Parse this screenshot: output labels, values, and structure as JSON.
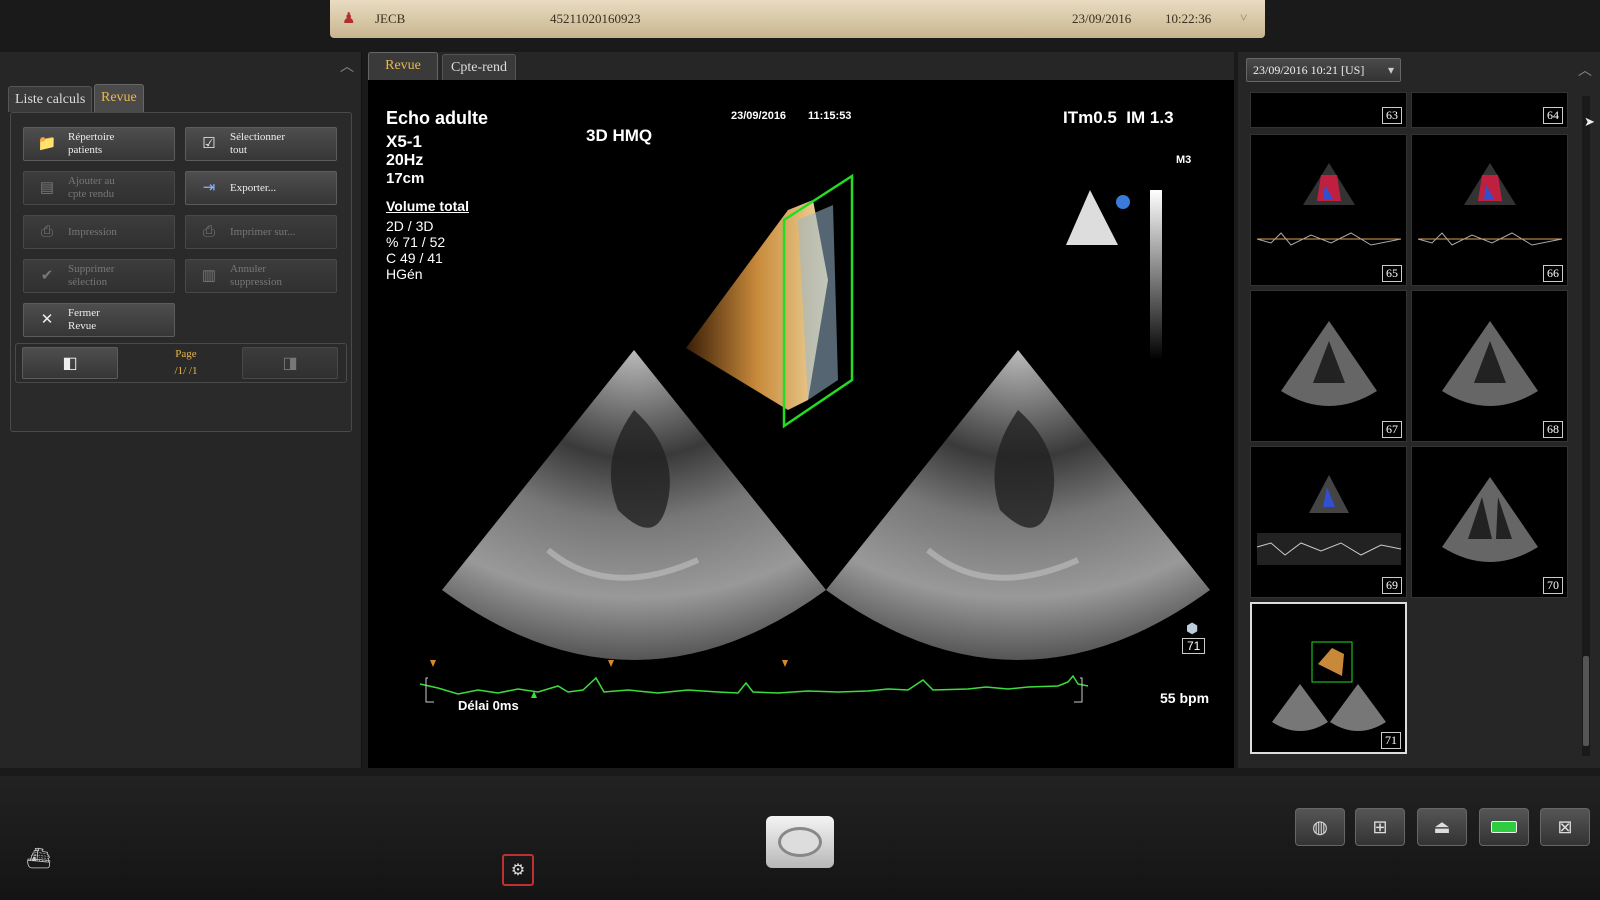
{
  "header": {
    "patient_name": "JECB",
    "patient_id": "45211020160923",
    "date": "23/09/2016",
    "time": "10:22:36"
  },
  "left_panel": {
    "tabs": [
      {
        "label": "Liste calculs",
        "active": false
      },
      {
        "label": "Revue",
        "active": true
      }
    ],
    "buttons": [
      {
        "label": "Répertoire\npatients",
        "enabled": true,
        "icon": "patient-folder-icon"
      },
      {
        "label": "Sélectionner\ntout",
        "enabled": true,
        "icon": "select-all-icon"
      },
      {
        "label": "Ajouter au\ncpte rendu",
        "enabled": false,
        "icon": "add-report-icon"
      },
      {
        "label": "Exporter...",
        "enabled": true,
        "icon": "export-icon"
      },
      {
        "label": "Impression",
        "enabled": false,
        "icon": "printer-icon"
      },
      {
        "label": "Imprimer sur...",
        "enabled": false,
        "icon": "print-to-icon"
      },
      {
        "label": "Supprimer\nsélection",
        "enabled": false,
        "icon": "delete-selection-icon"
      },
      {
        "label": "Annuler\nsuppression",
        "enabled": false,
        "icon": "undo-delete-icon"
      },
      {
        "label": "Fermer\nRevue",
        "enabled": true,
        "icon": "close-icon"
      }
    ],
    "page_label": "Page",
    "page_value": "/1/ /1"
  },
  "center": {
    "tabs": [
      {
        "label": "Revue",
        "active": true
      },
      {
        "label": "Cpte-rend",
        "active": false
      }
    ],
    "exam_type": "Echo adulte",
    "probe": "X5-1",
    "frequency": "20Hz",
    "depth": "17cm",
    "mode": "3D  HMQ",
    "image_date": "23/09/2016",
    "image_time": "11:15:53",
    "indices": "ITm0.5  IM 1.3",
    "map": "M3",
    "volume_title": "Volume total",
    "volume_values": "2D / 3D\n% 71 / 52\nC  49 / 41\nHGén",
    "image_number": "71",
    "delay": "Délai 0ms",
    "heart_rate": "55 bpm"
  },
  "right_panel": {
    "study_selector": "23/09/2016 10:21 [US]",
    "thumbnails": [
      {
        "number": "63",
        "kind": "partial"
      },
      {
        "number": "64",
        "kind": "partial"
      },
      {
        "number": "65",
        "kind": "doppler"
      },
      {
        "number": "66",
        "kind": "doppler"
      },
      {
        "number": "67",
        "kind": "bmode"
      },
      {
        "number": "68",
        "kind": "bmode"
      },
      {
        "number": "69",
        "kind": "mmode"
      },
      {
        "number": "70",
        "kind": "bmode"
      },
      {
        "number": "71",
        "kind": "3d",
        "selected": true
      }
    ]
  },
  "colors": {
    "accent": "#e8b84a",
    "ecg": "#3ddc3d",
    "crop_box": "#22dd22"
  }
}
